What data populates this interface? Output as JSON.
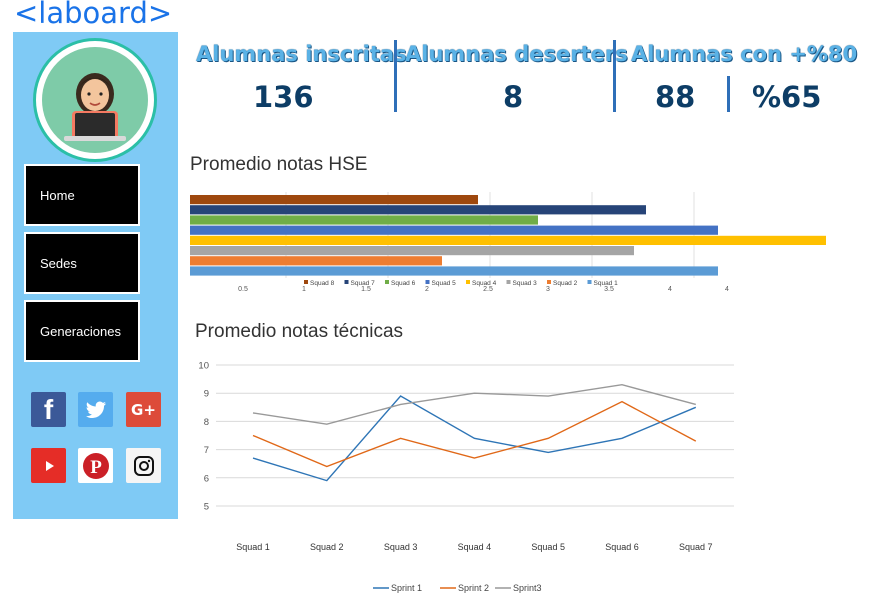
{
  "app": {
    "logo": "<laboard>"
  },
  "sidebar": {
    "nav": [
      {
        "label": "Home",
        "active": true
      },
      {
        "label": "Sedes",
        "active": false
      },
      {
        "label": "Generaciones",
        "active": false
      }
    ],
    "social": [
      {
        "name": "facebook-icon",
        "glyph": "f",
        "color": "#3b5998"
      },
      {
        "name": "twitter-icon",
        "glyph": "🐦",
        "color": "#55acee"
      },
      {
        "name": "google-plus-icon",
        "glyph": "G+",
        "color": "#dd4b39"
      },
      {
        "name": "youtube-icon",
        "glyph": "▶",
        "color": "#e52d27"
      },
      {
        "name": "pinterest-icon",
        "glyph": "P",
        "color": "#cb2027"
      },
      {
        "name": "instagram-icon",
        "glyph": "◎",
        "color": "#f5f5f5"
      }
    ]
  },
  "kpis": [
    {
      "title": "Alumnas inscritas",
      "value": "136"
    },
    {
      "title": "Alumnas deserters",
      "value": "8"
    },
    {
      "title": "Alumnas con +%80",
      "value": "88"
    },
    {
      "title": "",
      "value": "%65"
    }
  ],
  "hse": {
    "title": "Promedio notas HSE"
  },
  "tec": {
    "title": "Promedio notas técnicas"
  },
  "chart_data": [
    {
      "type": "bar",
      "orientation": "horizontal",
      "title": "Promedio notas HSE",
      "categories": [
        "Squad 8",
        "Squad 7",
        "Squad 6",
        "Squad 5",
        "Squad 4",
        "Squad 3",
        "Squad 2",
        "Squad 1"
      ],
      "values": [
        2.4,
        3.8,
        2.9,
        4.4,
        5.3,
        3.7,
        2.1,
        4.4
      ],
      "colors": [
        "#9e480e",
        "#264478",
        "#70ad47",
        "#4472c4",
        "#ffc000",
        "#a5a5a5",
        "#ed7d31",
        "#5b9bd5"
      ],
      "x_ticks": [
        "0.5",
        "1",
        "1.5",
        "2",
        "2.5",
        "3",
        "3.5",
        "4",
        "4"
      ],
      "legend": [
        "Squad 8",
        "Squad 7",
        "Squad 6",
        "Squad 5",
        "Squad 4",
        "Squad 3",
        "Squad 2",
        "Squad 1"
      ],
      "legend_position": "bottom",
      "grid": true
    },
    {
      "type": "line",
      "title": "Promedio notas técnicas",
      "categories": [
        "Squad 1",
        "Squad 2",
        "Squad 3",
        "Squad 4",
        "Squad 5",
        "Squad 6",
        "Squad 7"
      ],
      "series": [
        {
          "name": "Sprint 1",
          "values": [
            6.7,
            5.9,
            8.9,
            7.4,
            6.9,
            7.4,
            8.5
          ],
          "color": "#2e75b6"
        },
        {
          "name": "Sprint 2",
          "values": [
            7.5,
            6.4,
            7.4,
            6.7,
            7.4,
            8.7,
            7.3
          ],
          "color": "#e06818"
        },
        {
          "name": "Sprint3",
          "values": [
            8.3,
            7.9,
            8.6,
            9.0,
            8.9,
            9.3,
            8.6
          ],
          "color": "#999999"
        }
      ],
      "y_ticks": [
        "5",
        "6",
        "7",
        "8",
        "9",
        "10"
      ],
      "ylim": [
        5,
        10
      ],
      "legend_position": "bottom",
      "grid": true
    }
  ]
}
